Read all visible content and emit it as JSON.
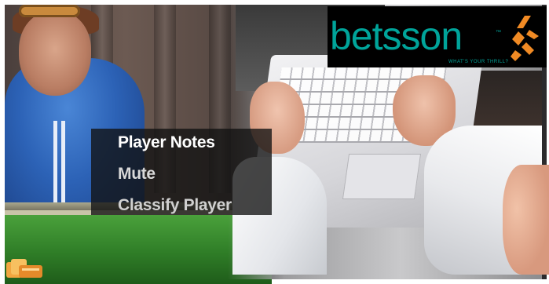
{
  "menu": {
    "items": [
      {
        "label": "Player Notes"
      },
      {
        "label": "Mute"
      },
      {
        "label": "Classify Player"
      }
    ]
  },
  "logo": {
    "word": "betsson",
    "trademark": "™",
    "tagline": "WHAT'S YOUR THRILL?",
    "colors": {
      "text": "#00a49a",
      "bolt": "#f08a24",
      "background": "#000000"
    }
  },
  "icons": {
    "bottom_left": "poker-chips-icon",
    "logo_mark": "bolt-mark-icon"
  }
}
